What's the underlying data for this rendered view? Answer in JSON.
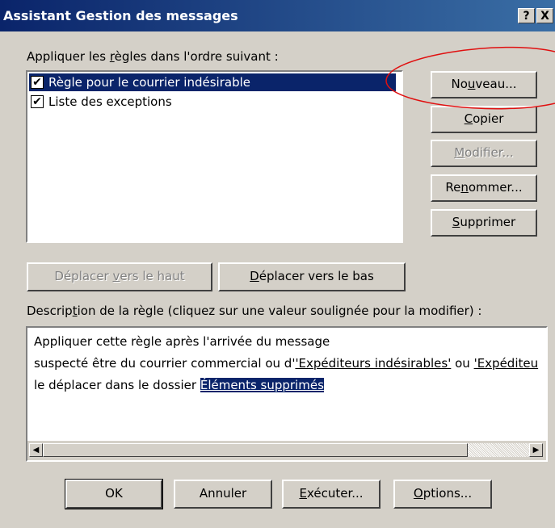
{
  "window": {
    "title": "Assistant Gestion des messages",
    "help_btn": "?",
    "close_btn": "X"
  },
  "rules": {
    "label_before": "Appliquer les ",
    "label_access": "r",
    "label_after": "ègles dans l'ordre suivant :",
    "items": [
      {
        "label": "Règle pour le courrier indésirable",
        "checked": true,
        "selected": true
      },
      {
        "label": "Liste des exceptions",
        "checked": true,
        "selected": false
      }
    ],
    "check_glyph": "✔"
  },
  "side_buttons": {
    "new_a": "No",
    "new_u": "u",
    "new_b": "veau...",
    "copy_u": "C",
    "copy_b": "opier",
    "modify_u": "M",
    "modify_b": "odifier...",
    "rename_a": "Re",
    "rename_u": "n",
    "rename_b": "ommer...",
    "delete_u": "S",
    "delete_b": "upprimer"
  },
  "move": {
    "up_a": "Déplacer ",
    "up_u": "v",
    "up_b": "ers le haut",
    "down_u": "D",
    "down_b": "éplacer vers le bas"
  },
  "description": {
    "label_before": "Descrip",
    "label_access": "t",
    "label_after": "ion de la règle (cliquez sur une valeur soulignée pour la modifier) :",
    "line1": "Appliquer cette règle après l'arrivée du message",
    "line2_a": "suspecté être du courrier commercial ou d'",
    "line2_link1": "'Expéditeurs indésirables'",
    "line2_mid": " ou ",
    "line2_link2": "'Expéditeu",
    "line3_a": "le déplacer dans le dossier ",
    "line3_link": "Éléments supprimés"
  },
  "bottom_buttons": {
    "ok": "OK",
    "cancel": "Annuler",
    "run_u": "E",
    "run_b": "xécuter...",
    "options_u": "O",
    "options_b": "ptions..."
  },
  "scrollbar": {
    "left_arrow": "◀",
    "right_arrow": "▶"
  },
  "colors": {
    "selection": "#0a246a",
    "dialog_bg": "#d4d0c8",
    "annotation_ellipse": "#e01010"
  }
}
